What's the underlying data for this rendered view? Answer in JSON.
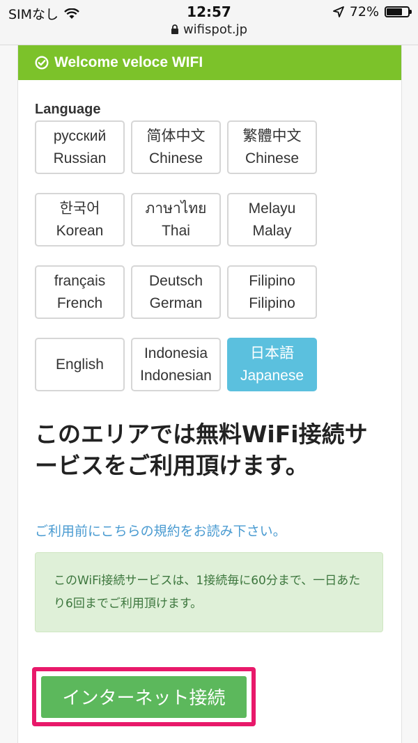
{
  "status_bar": {
    "carrier": "SIMなし",
    "time": "12:57",
    "battery_text": "72%",
    "battery_level": 0.72,
    "url": "wifispot.jp",
    "icons": [
      "wifi-icon",
      "location-arrow-icon",
      "battery-icon",
      "lock-icon"
    ]
  },
  "banner": {
    "title": "Welcome veloce WIFI",
    "color": "#7cc22a",
    "icon": "check-circle-icon"
  },
  "language": {
    "label": "Language",
    "selected": "Japanese",
    "selected_color": "#5bc0de",
    "options": [
      {
        "native": "русский",
        "english": "Russian"
      },
      {
        "native": "简体中文",
        "english": "Chinese"
      },
      {
        "native": "繁體中文",
        "english": "Chinese"
      },
      {
        "native": "한국어",
        "english": "Korean"
      },
      {
        "native": "ภาษาไทย",
        "english": "Thai"
      },
      {
        "native": "Melayu",
        "english": "Malay"
      },
      {
        "native": "français",
        "english": "French"
      },
      {
        "native": "Deutsch",
        "english": "German"
      },
      {
        "native": "Filipino",
        "english": "Filipino"
      },
      {
        "native": "",
        "english": "English"
      },
      {
        "native": "Indonesia",
        "english": "Indonesian"
      },
      {
        "native": "日本語",
        "english": "Japanese"
      }
    ]
  },
  "main": {
    "headline": "このエリアでは無料WiFi接続サービスをご利用頂けます。",
    "terms_link": "ご利用前にこちらの規約をお読み下さい。",
    "notice": "このWiFi接続サービスは、1接続毎に60分まで、一日あたり6回までご利用頂けます。",
    "connect_button": "インターネット接続",
    "connect_color": "#5cb85c",
    "highlight_color": "#e8196a"
  }
}
